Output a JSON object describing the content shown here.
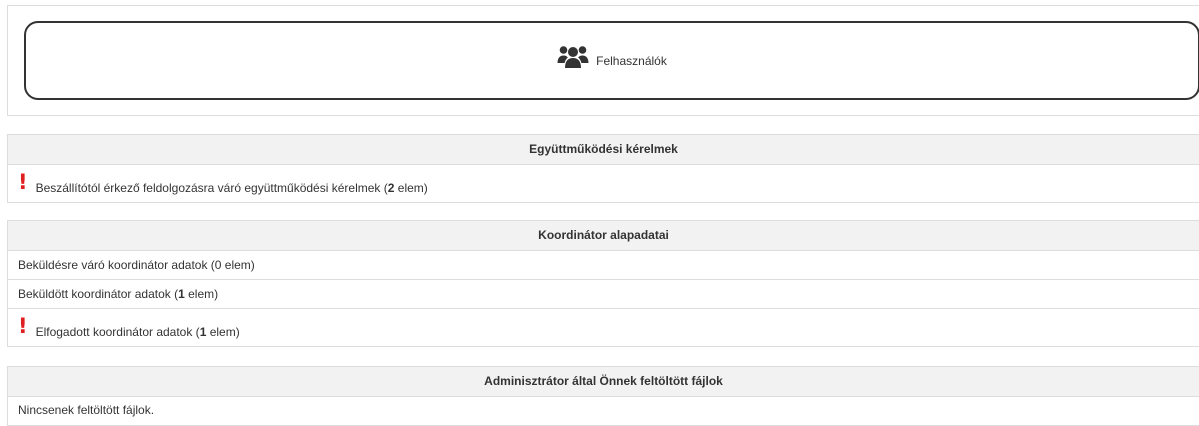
{
  "users_button": {
    "label": "Felhasználók",
    "icon": "users-icon"
  },
  "cooperation": {
    "title": "Együttműködési kérelmek",
    "rows": [
      {
        "prefix": "Beszállítótól érkező feldolgozásra váró együttműködési kérelmek (",
        "count": "2",
        "suffix": " elem)",
        "alert": true
      }
    ]
  },
  "coordinator": {
    "title": "Koordinátor alapadatai",
    "rows": [
      {
        "text": "Beküldésre váró koordinátor adatok (0 elem)"
      },
      {
        "prefix": "Beküldött koordinátor adatok (",
        "count": "1",
        "suffix": " elem)"
      },
      {
        "prefix": "Elfogadott koordinátor adatok (",
        "count": "1",
        "suffix": " elem)",
        "alert": true
      }
    ]
  },
  "files": {
    "title": "Adminisztrátor által Önnek feltöltött fájlok",
    "empty_text": "Nincsenek feltöltött fájlok."
  },
  "alert_mark": "!",
  "colors": {
    "alert": "#e02020",
    "header_bg": "#f2f2f2",
    "border": "#dddddd",
    "text": "#333333"
  }
}
